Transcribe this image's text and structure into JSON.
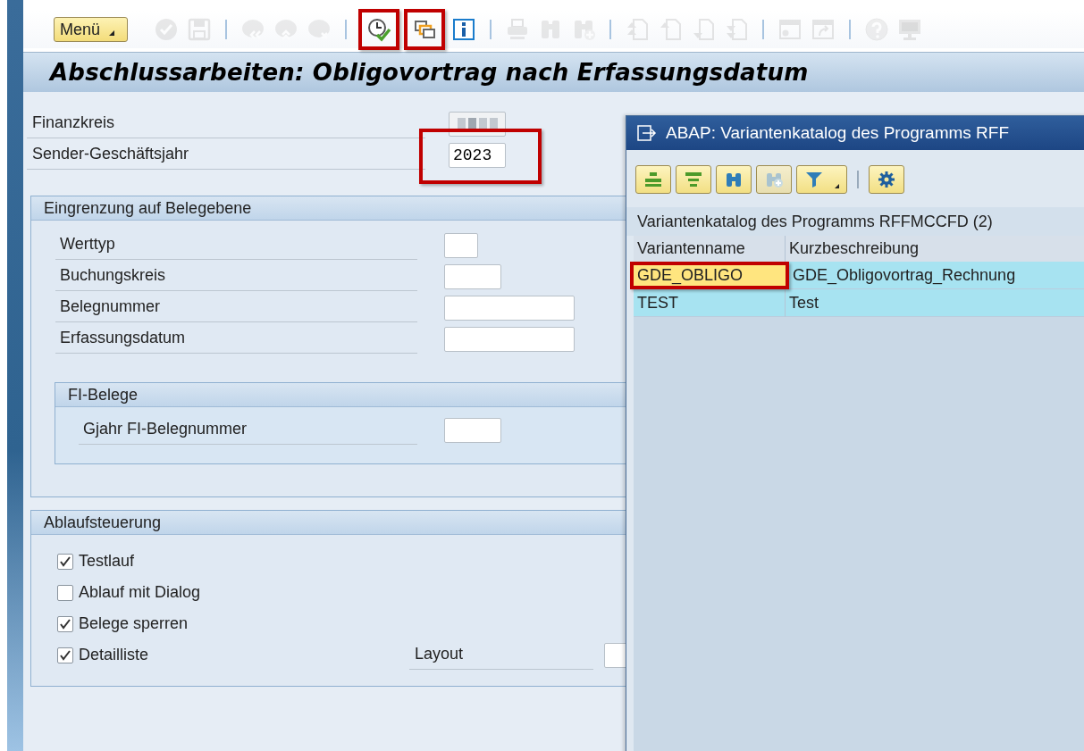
{
  "toolbar": {
    "menu": {
      "label": "Menü"
    },
    "icons": [
      {
        "kind": "check",
        "disabled": true,
        "highlighted": false
      },
      {
        "kind": "save",
        "disabled": true,
        "highlighted": false
      },
      {
        "kind": "separator"
      },
      {
        "kind": "back",
        "disabled": true,
        "highlighted": false
      },
      {
        "kind": "up",
        "disabled": true,
        "highlighted": false
      },
      {
        "kind": "cancel",
        "disabled": true,
        "highlighted": false
      },
      {
        "kind": "separator"
      },
      {
        "kind": "execute",
        "disabled": false,
        "highlighted": true
      },
      {
        "kind": "variants",
        "disabled": false,
        "highlighted": true
      },
      {
        "kind": "info",
        "disabled": false,
        "highlighted": false
      },
      {
        "kind": "separator"
      },
      {
        "kind": "print",
        "disabled": true,
        "highlighted": false
      },
      {
        "kind": "find",
        "disabled": true,
        "highlighted": false
      },
      {
        "kind": "find-next",
        "disabled": true,
        "highlighted": false
      },
      {
        "kind": "separator"
      },
      {
        "kind": "first-page",
        "disabled": true,
        "highlighted": false
      },
      {
        "kind": "previous-page",
        "disabled": true,
        "highlighted": false
      },
      {
        "kind": "next-page",
        "disabled": true,
        "highlighted": false
      },
      {
        "kind": "last-page",
        "disabled": true,
        "highlighted": false
      },
      {
        "kind": "separator"
      },
      {
        "kind": "new-window",
        "disabled": true,
        "highlighted": false
      },
      {
        "kind": "shortcut",
        "disabled": true,
        "highlighted": false
      },
      {
        "kind": "separator"
      },
      {
        "kind": "help",
        "disabled": true,
        "highlighted": false
      },
      {
        "kind": "monitor",
        "disabled": true,
        "highlighted": false
      }
    ]
  },
  "title": "Abschlussarbeiten: Obligovortrag nach Erfassungsdatum",
  "top_fields": [
    {
      "label": "Finanzkreis",
      "blurred": true,
      "highlighted": false
    },
    {
      "label": "Sender-Geschäftsjahr",
      "value": "2023",
      "blurred": false,
      "highlighted": true
    }
  ],
  "selection_group": {
    "title": "Eingrenzung auf Belegebene",
    "fields": [
      {
        "label": "Werttyp"
      },
      {
        "label": "Buchungskreis"
      },
      {
        "label": "Belegnummer"
      },
      {
        "label": "Erfassungsdatum"
      }
    ],
    "subgroup": {
      "title": "FI-Belege",
      "fields": [
        {
          "label": "Gjahr FI-Belegnummer"
        }
      ]
    }
  },
  "control_group": {
    "title": "Ablaufsteuerung",
    "checkboxes": [
      {
        "label": "Testlauf",
        "checked": true
      },
      {
        "label": "Ablauf mit Dialog",
        "checked": false
      },
      {
        "label": "Belege sperren",
        "checked": true
      },
      {
        "label": "Detailliste",
        "checked": true
      }
    ],
    "layout_field": {
      "label": "Layout"
    }
  },
  "dialog": {
    "title": "ABAP: Variantenkatalog des Programms RFF",
    "buttons": [
      {
        "kind": "select",
        "disabled": false
      },
      {
        "kind": "filter-lines",
        "disabled": false
      },
      {
        "kind": "find",
        "disabled": false
      },
      {
        "kind": "find-next",
        "disabled": true
      },
      {
        "kind": "filter",
        "disabled": false
      },
      {
        "kind": "separator"
      },
      {
        "kind": "settings",
        "disabled": false
      }
    ],
    "caption": "Variantenkatalog des Programms RFFMCCFD (2)",
    "columns": [
      "Variantenname",
      "Kurzbeschreibung"
    ],
    "rows": [
      {
        "cells": [
          "GDE_OBLIGO",
          "GDE_Obligovortrag_Rechnung"
        ],
        "focused": true,
        "highlighted": true
      },
      {
        "cells": [
          "TEST",
          "Test"
        ],
        "focused": false,
        "highlighted": false
      }
    ]
  }
}
